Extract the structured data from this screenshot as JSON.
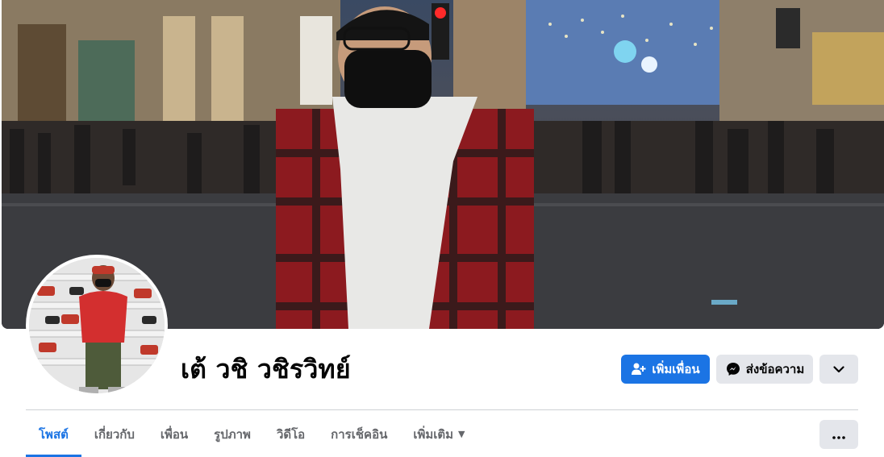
{
  "profile": {
    "name": "เต้ วชิ วชิรวิทย์"
  },
  "actions": {
    "add_friend_label": "เพิ่มเพื่อน",
    "message_label": "ส่งข้อความ"
  },
  "tabs": [
    {
      "label": "โพสต์",
      "active": true
    },
    {
      "label": "เกี่ยวกับ"
    },
    {
      "label": "เพื่อน"
    },
    {
      "label": "รูปภาพ"
    },
    {
      "label": "วิดีโอ"
    },
    {
      "label": "การเช็คอิน"
    },
    {
      "label": "เพิ่มเติม"
    }
  ],
  "colors": {
    "accent": "#1b74e4",
    "button_gray": "#e4e6eb",
    "text_primary": "#050505",
    "text_secondary": "#65676b"
  },
  "icons": {
    "add_friend": "person-plus-icon",
    "message": "messenger-icon",
    "dropdown": "chevron-down-icon",
    "more": "more-horizontal-icon"
  }
}
